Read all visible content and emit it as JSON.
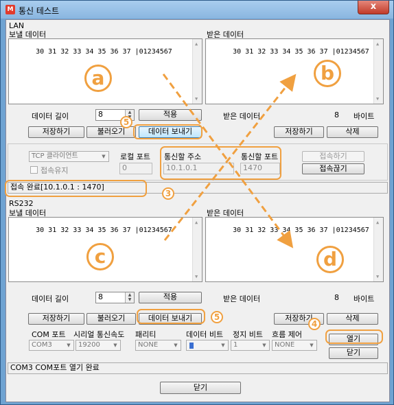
{
  "window": {
    "app_icon": "M",
    "title": "통신 테스트",
    "close_glyph": "x"
  },
  "lan": {
    "group_label": "LAN",
    "send_label": "보낼 데이터",
    "recv_label": "받은 데이터",
    "send_text": "30 31 32 33 34 35 36 37 |01234567",
    "recv_text": "30 31 32 33 34 35 36 37 |01234567",
    "data_length_label": "데이터 길이",
    "data_length_value": "8",
    "apply_button": "적용",
    "recv_data_label": "받은 데이터",
    "recv_count": "8",
    "bytes_unit": "바이트",
    "save_button": "저장하기",
    "load_button": "불러오기",
    "send_button": "데이터 보내기",
    "save_recv_button": "저장하기",
    "delete_button": "삭제",
    "tcp_mode": "TCP 클라이언트",
    "local_port_label": "로컬 포트",
    "local_port_value": "0",
    "target_addr_label": "통신할 주소",
    "target_addr_value": "10.1.0.1",
    "target_port_label": "통신할 포트",
    "target_port_value": "1470",
    "keep_connection_label": "접속유지",
    "connect_button": "접속하기",
    "disconnect_button": "접속끊기",
    "status_text": "접속 완료[10.1.0.1 : 1470]"
  },
  "rs232": {
    "group_label": "RS232",
    "send_label": "보낼 데이터",
    "recv_label": "받은 데이터",
    "send_text": "30 31 32 33 34 35 36 37 |01234567",
    "recv_text": "30 31 32 33 34 35 36 37 |01234567",
    "data_length_label": "데이터 길이",
    "data_length_value": "8",
    "apply_button": "적용",
    "recv_data_label": "받은 데이터",
    "recv_count": "8",
    "bytes_unit": "바이트",
    "save_button": "저장하기",
    "load_button": "불러오기",
    "send_button": "데이터 보내기",
    "save_recv_button": "저장하기",
    "delete_button": "삭제",
    "com_port_label": "COM 포트",
    "com_port_value": "COM3",
    "baud_label": "시리얼 통신속도",
    "baud_value": "19200",
    "parity_label": "패리티",
    "parity_value": "NONE",
    "data_bits_label": "데이터 비트",
    "stop_bits_label": "정지 비트",
    "stop_bits_value": "1",
    "flow_label": "흐름 제어",
    "flow_value": "NONE",
    "open_button": "열기",
    "close_port_button": "닫기",
    "status_text": "COM3 COM포트 열기 완료"
  },
  "footer": {
    "close_button": "닫기"
  },
  "annotations": {
    "a": "a",
    "b": "b",
    "c": "c",
    "d": "d",
    "step3": "3",
    "step4": "4",
    "step5_lan": "5",
    "step5_rs": "5",
    "color": "#f0a040"
  }
}
